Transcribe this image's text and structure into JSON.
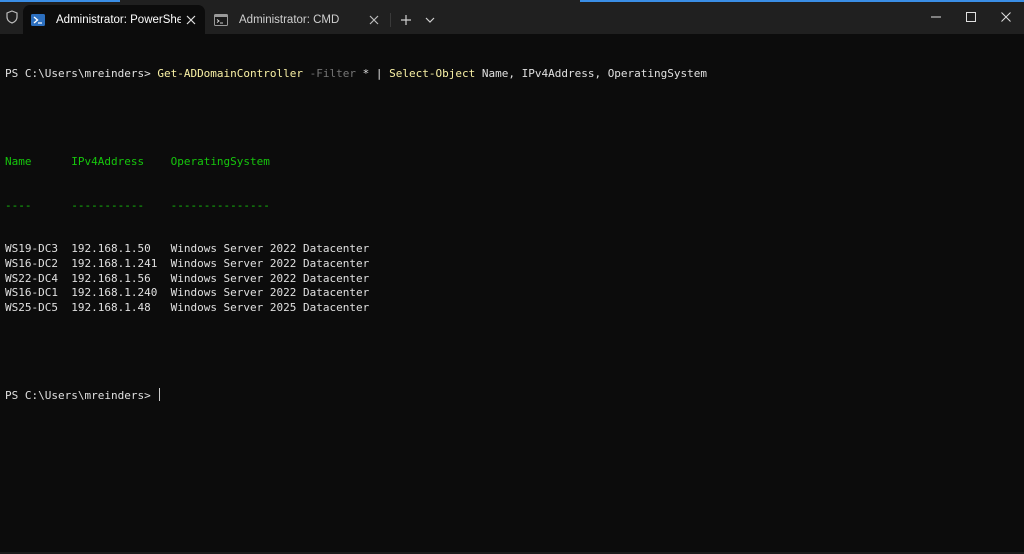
{
  "tabs": [
    {
      "label": "Administrator: PowerShell",
      "icon": "powershell-icon",
      "active": true
    },
    {
      "label": "Administrator: CMD",
      "icon": "cmd-icon",
      "active": false
    }
  ],
  "prompt": "PS C:\\Users\\mreinders> ",
  "command": {
    "cmdlet1": "Get-ADDomainController",
    "param": "-Filter",
    "arg": "*",
    "pipe": "|",
    "cmdlet2": "Select-Object",
    "props": "Name, IPv4Address, OperatingSystem"
  },
  "table": {
    "headers": [
      "Name",
      "IPv4Address",
      "OperatingSystem"
    ],
    "underline": [
      "----",
      "-----------",
      "---------------"
    ],
    "rows": [
      [
        "WS19-DC3",
        "192.168.1.50",
        "Windows Server 2022 Datacenter"
      ],
      [
        "WS16-DC2",
        "192.168.1.241",
        "Windows Server 2022 Datacenter"
      ],
      [
        "WS22-DC4",
        "192.168.1.56",
        "Windows Server 2022 Datacenter"
      ],
      [
        "WS16-DC1",
        "192.168.1.240",
        "Windows Server 2022 Datacenter"
      ],
      [
        "WS25-DC5",
        "192.168.1.48",
        "Windows Server 2025 Datacenter"
      ]
    ]
  },
  "colors": {
    "background": "#0c0c0c",
    "titlebar": "#202020",
    "cmdlet": "#f9f1a5",
    "parameter": "#767676",
    "header": "#16c60c",
    "text": "#cccccc"
  },
  "icons": {
    "shield": "shield-icon",
    "close": "close-icon",
    "new_tab": "plus-icon",
    "dropdown": "chevron-down-icon",
    "minimize": "minimize-icon",
    "maximize": "maximize-icon",
    "window_close": "window-close-icon"
  }
}
